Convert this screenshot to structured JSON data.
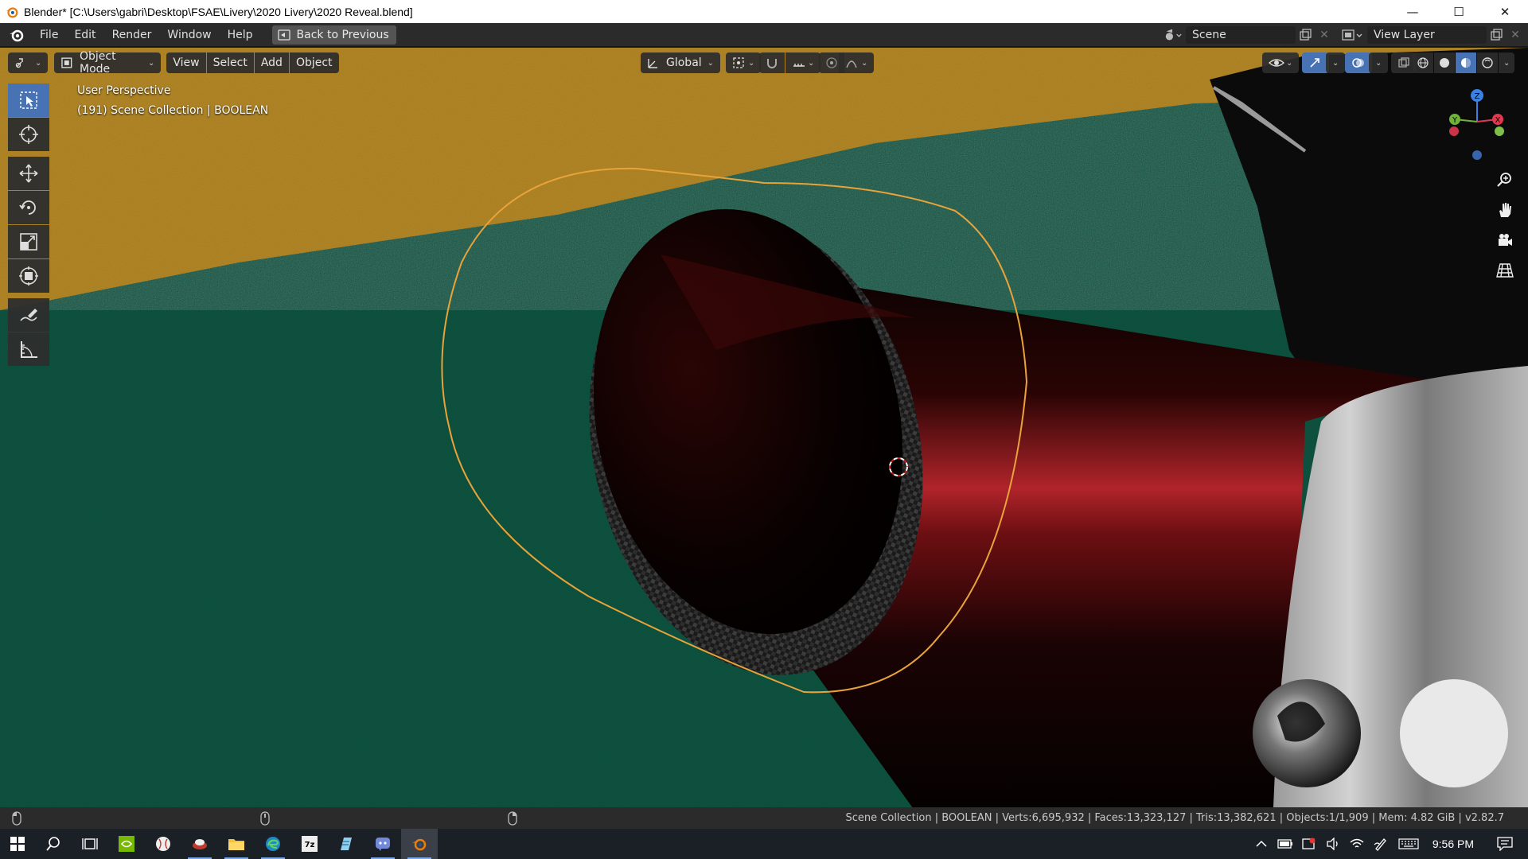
{
  "window": {
    "title": "Blender* [C:\\Users\\gabri\\Desktop\\FSAE\\Livery\\2020 Livery\\2020 Reveal.blend]",
    "minimize": "—",
    "maximize": "☐",
    "close": "✕"
  },
  "menu": {
    "items": [
      "File",
      "Edit",
      "Render",
      "Window",
      "Help"
    ],
    "back_to_previous": "Back to Previous"
  },
  "topbar_right": {
    "scene": "Scene",
    "view_layer": "View Layer"
  },
  "viewport_header": {
    "mode": "Object Mode",
    "view": "View",
    "select": "Select",
    "add": "Add",
    "object": "Object",
    "orientation": "Global"
  },
  "viewport_overlay": {
    "perspective": "User Perspective",
    "collection_info": "(191) Scene Collection | BOOLEAN"
  },
  "gizmo": {
    "z": "Z",
    "y": "Y",
    "x": "X"
  },
  "statusbar": {
    "stats": "Scene Collection | BOOLEAN | Verts:6,695,932 | Faces:13,323,127 | Tris:13,382,621 | Objects:1/1,909 | Mem: 4.82 GiB | v2.82.7"
  },
  "taskbar": {
    "clock": "9:56 PM"
  },
  "colors": {
    "accent": "#4772b3",
    "selection_outline": "#e8a33a",
    "floor_green": "#0d5340",
    "wall_yellow": "#b38726"
  }
}
